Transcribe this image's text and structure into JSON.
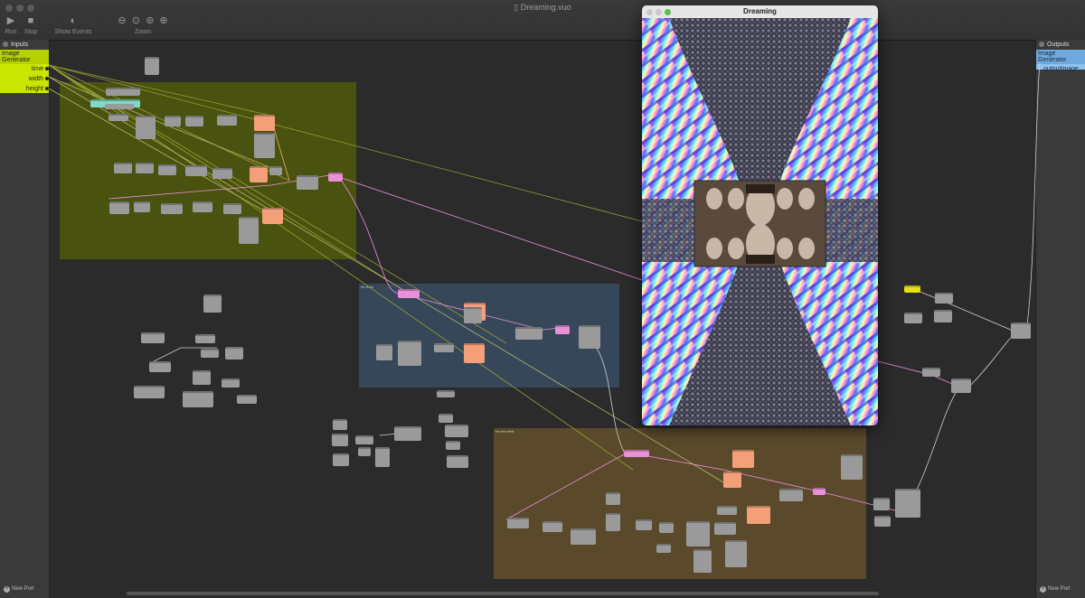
{
  "window": {
    "title": "Dreaming.vuo"
  },
  "toolbar": {
    "run_label": "Run",
    "stop_label": "Stop",
    "show_events_label": "Show Events",
    "zoom_label": "Zoom"
  },
  "inputs_panel": {
    "title": "Inputs",
    "generator_label": "Image Generator",
    "ports": [
      "time",
      "width",
      "height"
    ],
    "new_port_label": "New Port"
  },
  "outputs_panel": {
    "title": "Outputs",
    "generator_label": "Image Generator",
    "ports": [
      "outputImage"
    ],
    "new_port_label": "New Port"
  },
  "preview": {
    "title": "Dreaming"
  },
  "colors": {
    "group_olive": "#4a5210",
    "group_blue": "#36475a",
    "group_brown": "#5a4a2b",
    "node_gray": "#9a9a9a",
    "node_orange": "#f3a07a",
    "node_pink": "#e890d8",
    "wire_pink": "#e890d8",
    "wire_olive": "#9aa030"
  },
  "icons": [
    "play-icon",
    "stop-icon",
    "show-events-icon",
    "zoom-out-icon",
    "zoom-actual-icon",
    "zoom-fit-icon",
    "zoom-in-icon"
  ]
}
